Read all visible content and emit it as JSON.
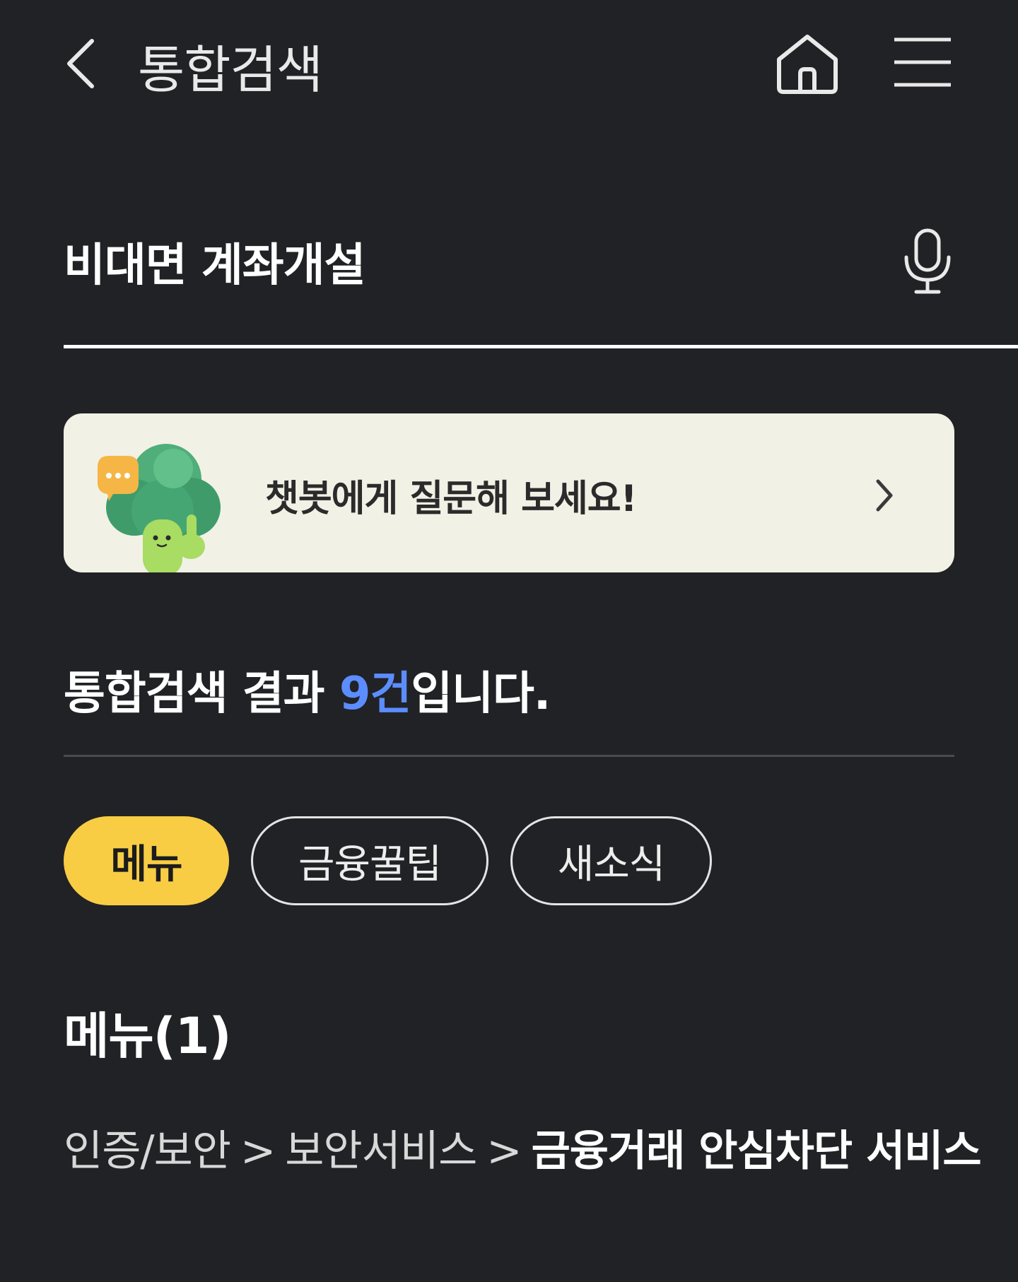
{
  "header": {
    "title": "통합검색"
  },
  "search": {
    "value": "비대면 계좌개설"
  },
  "chatbot": {
    "text": "챗봇에게 질문해 보세요!"
  },
  "results": {
    "prefix": "통합검색 결과 ",
    "count": "9건",
    "suffix": "입니다."
  },
  "filters": {
    "menu": "메뉴",
    "tips": "금융꿀팁",
    "news": "새소식"
  },
  "section": {
    "title": "메뉴(1)",
    "item": {
      "crumb1": "인증/보안",
      "sep1": ">",
      "crumb2": "보안서비스",
      "sep2": ">",
      "current": "금융거래 안심차단 서비스"
    }
  },
  "colors": {
    "background": "#212225",
    "accent_yellow": "#f8cd44",
    "count_blue": "#5c8dff",
    "banner_bg": "#f1f1e6"
  },
  "icons": {
    "back": "chevron-left-icon",
    "home": "home-icon",
    "menu": "hamburger-menu-icon",
    "mic": "microphone-icon",
    "chatbot_arrow": "chevron-right-icon"
  }
}
